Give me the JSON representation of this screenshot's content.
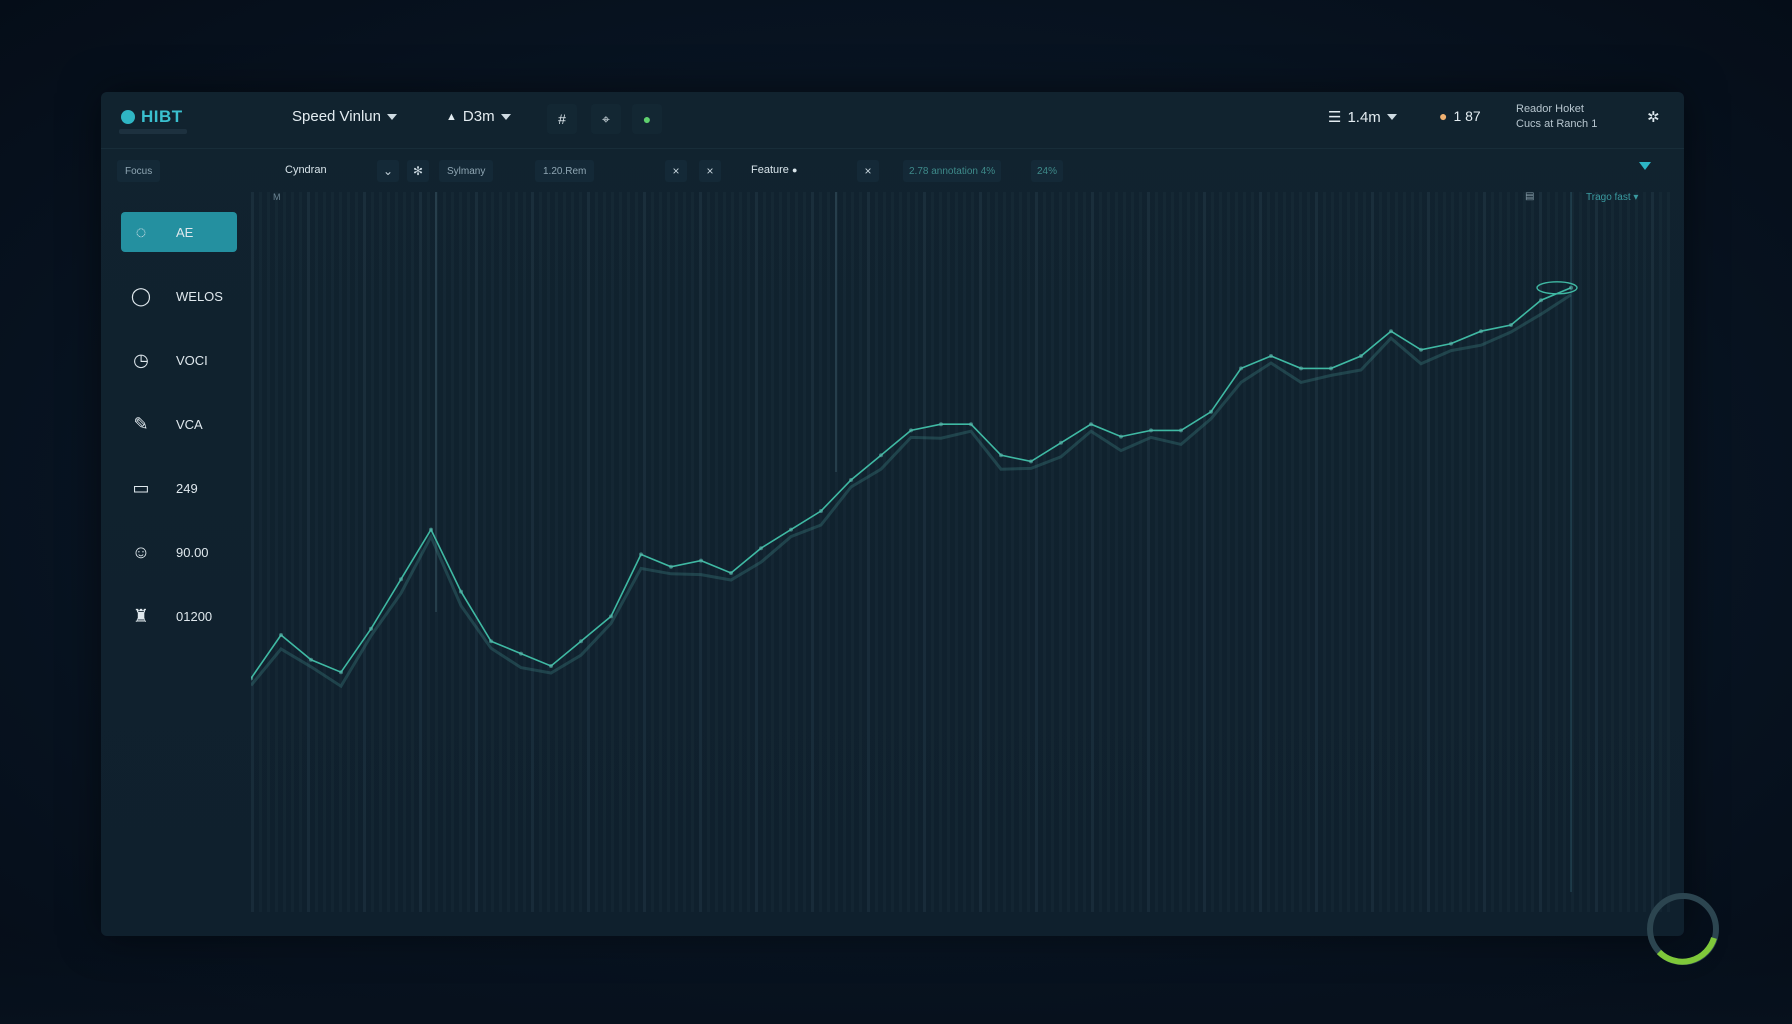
{
  "header": {
    "brand": "HIBT",
    "workspace": "Speed Vinlun",
    "timeframe": "D3m",
    "zoom": "1.4m",
    "alerts": "1 87",
    "user_line1": "Reador Hoket",
    "user_line2": "Cucs at Ranch 1"
  },
  "toolbar": {
    "filter": "Focus",
    "symbol": "Cyndran",
    "field_a": "Sylmany",
    "field_b": "1.20.Rem",
    "feature_label": "Feature",
    "range_a": "2.78 annotation 4%",
    "range_b": "24%"
  },
  "sidebar": {
    "items": [
      {
        "label": "AE",
        "icon": "cycle-icon"
      },
      {
        "label": "WELOS",
        "icon": "chat-bubble-icon"
      },
      {
        "label": "VOCI",
        "icon": "clock-icon"
      },
      {
        "label": "VCA",
        "icon": "pencil-icon"
      },
      {
        "label": "249",
        "icon": "card-icon"
      },
      {
        "label": "90.00",
        "icon": "face-icon"
      },
      {
        "label": "01200",
        "icon": "robot-icon"
      }
    ]
  },
  "chart": {
    "corner_left": "M",
    "corner_right_label": "Trago fast"
  },
  "chart_data": {
    "type": "line",
    "x": [
      0,
      1,
      2,
      3,
      4,
      5,
      6,
      7,
      8,
      9,
      10,
      11,
      12,
      13,
      14,
      15,
      16,
      17,
      18,
      19,
      20,
      21,
      22,
      23,
      24,
      25,
      26,
      27,
      28,
      29,
      30,
      31,
      32,
      33,
      34,
      35,
      36,
      37,
      38,
      39,
      40,
      41,
      42,
      43,
      44
    ],
    "series": [
      {
        "values": [
          0.28,
          0.35,
          0.31,
          0.29,
          0.36,
          0.44,
          0.52,
          0.42,
          0.34,
          0.32,
          0.3,
          0.34,
          0.38,
          0.48,
          0.46,
          0.47,
          0.45,
          0.49,
          0.52,
          0.55,
          0.6,
          0.64,
          0.68,
          0.69,
          0.69,
          0.64,
          0.63,
          0.66,
          0.69,
          0.67,
          0.68,
          0.68,
          0.71,
          0.78,
          0.8,
          0.78,
          0.78,
          0.8,
          0.84,
          0.81,
          0.82,
          0.84,
          0.85,
          0.89,
          0.91
        ]
      }
    ],
    "ylim": [
      0,
      1
    ],
    "grid": true
  }
}
